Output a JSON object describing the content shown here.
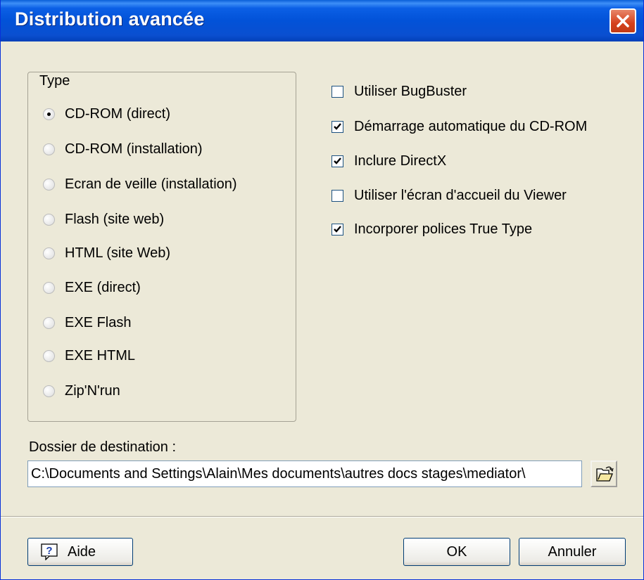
{
  "window": {
    "title": "Distribution avancée"
  },
  "type_group": {
    "legend": "Type",
    "options": [
      {
        "label": "CD-ROM (direct)",
        "checked": true
      },
      {
        "label": "CD-ROM (installation)",
        "checked": false
      },
      {
        "label": "Ecran de veille (installation)",
        "checked": false
      },
      {
        "label": "Flash (site web)",
        "checked": false
      },
      {
        "label": "HTML (site Web)",
        "checked": false
      },
      {
        "label": "EXE (direct)",
        "checked": false
      },
      {
        "label": "EXE Flash",
        "checked": false
      },
      {
        "label": "EXE HTML",
        "checked": false
      },
      {
        "label": "Zip'N'run",
        "checked": false
      }
    ]
  },
  "options": [
    {
      "label": "Utiliser BugBuster",
      "checked": false
    },
    {
      "label": "Démarrage automatique du CD-ROM",
      "checked": true
    },
    {
      "label": "Inclure DirectX",
      "checked": true
    },
    {
      "label": "Utiliser l'écran d'accueil du Viewer",
      "checked": false
    },
    {
      "label": "Incorporer polices True Type",
      "checked": true
    }
  ],
  "destination": {
    "label": "Dossier de destination :",
    "value": "C:\\Documents and Settings\\Alain\\Mes documents\\autres docs stages\\mediator\\"
  },
  "buttons": {
    "help": "Aide",
    "ok": "OK",
    "cancel": "Annuler"
  },
  "icons": {
    "close": "close-icon",
    "browse": "folder-open-icon",
    "help": "help-icon"
  },
  "colors": {
    "titlebar": "#0252d8",
    "close": "#d5411c",
    "dialog_bg": "#ece9d8"
  }
}
